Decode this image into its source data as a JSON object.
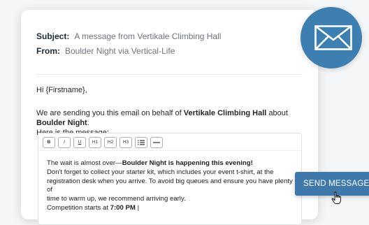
{
  "email": {
    "subject_label": "Subject:",
    "subject_value": "A message from Vertikale Climbing Hall",
    "from_label": "From:",
    "from_value": "Boulder Night via Vertical-Life",
    "greeting": "Hi {Firstname},",
    "intro_part1": "We are sending you this email on behalf of ",
    "intro_org": "Vertikale Climbing Hall",
    "intro_part2": " about ",
    "intro_event": "Boulder Night",
    "intro_part3": ".",
    "intro_line2": "Here is the message:"
  },
  "toolbar": {
    "bold": "B",
    "italic": "I",
    "underline": "U",
    "h1": "H1",
    "h2": "H2",
    "h3": "H3",
    "list_icon": "list-icon",
    "hr_icon": "horizontal-rule-icon"
  },
  "editor": {
    "line1_plain": "The wait is almost over—",
    "line1_bold": "Boulder Night is happening this evening!",
    "line2": "Don't forget to collect your starter kit, which includes your event t-shirt, at the",
    "line3": "registration desk when you arrive. To avoid big queues and ensure you have plenty of",
    "line4": "time to warm up, we recommend arriving early.",
    "line5_plain": "Competition starts at ",
    "line5_bold": "7:00 PM",
    "line5_caret": " |"
  },
  "send_button": {
    "label": "SEND MESSAGE"
  },
  "colors": {
    "accent": "#3f78ab",
    "badge": "#3d7fb0"
  }
}
